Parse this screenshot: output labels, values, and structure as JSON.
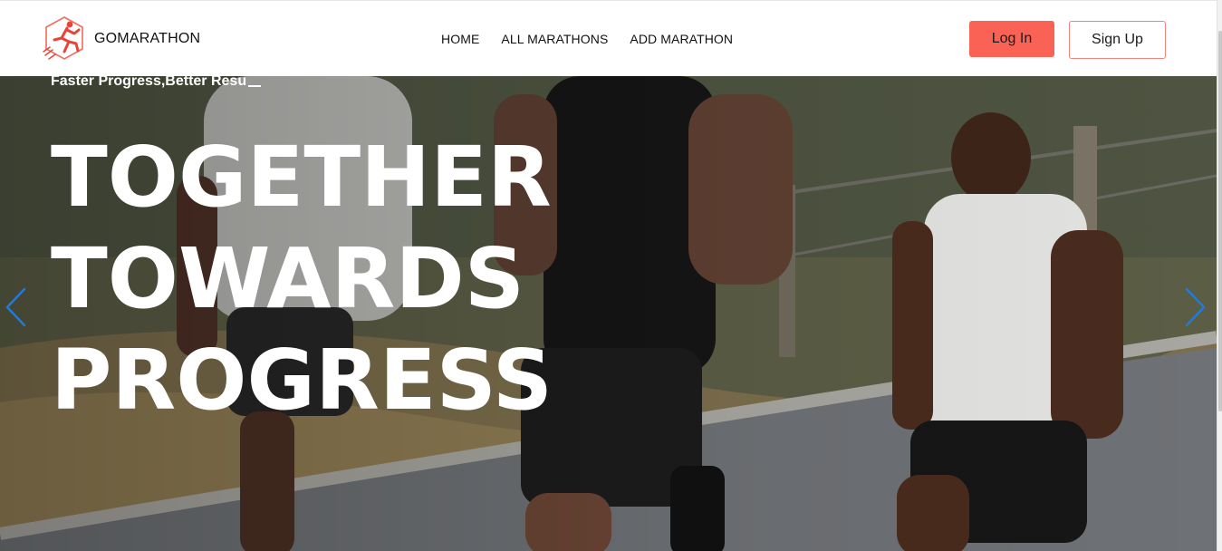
{
  "header": {
    "brand": "GOMARATHON",
    "nav": [
      {
        "label": "HOME"
      },
      {
        "label": "ALL MARATHONS"
      },
      {
        "label": "ADD MARATHON"
      }
    ],
    "login_label": "Log In",
    "signup_label": "Sign Up"
  },
  "hero": {
    "tagline": "Faster Progress,Better Resu",
    "headline": [
      "TOGETHER",
      "TOWARDS",
      "PROGRESS"
    ]
  },
  "colors": {
    "accent": "#fa6255",
    "accent_border": "#f0847a",
    "carousel_arrow": "#1e7be0",
    "text_dark": "#111111"
  },
  "icons": {
    "logo": "runner-logo-icon",
    "prev": "chevron-left-icon",
    "next": "chevron-right-icon"
  }
}
